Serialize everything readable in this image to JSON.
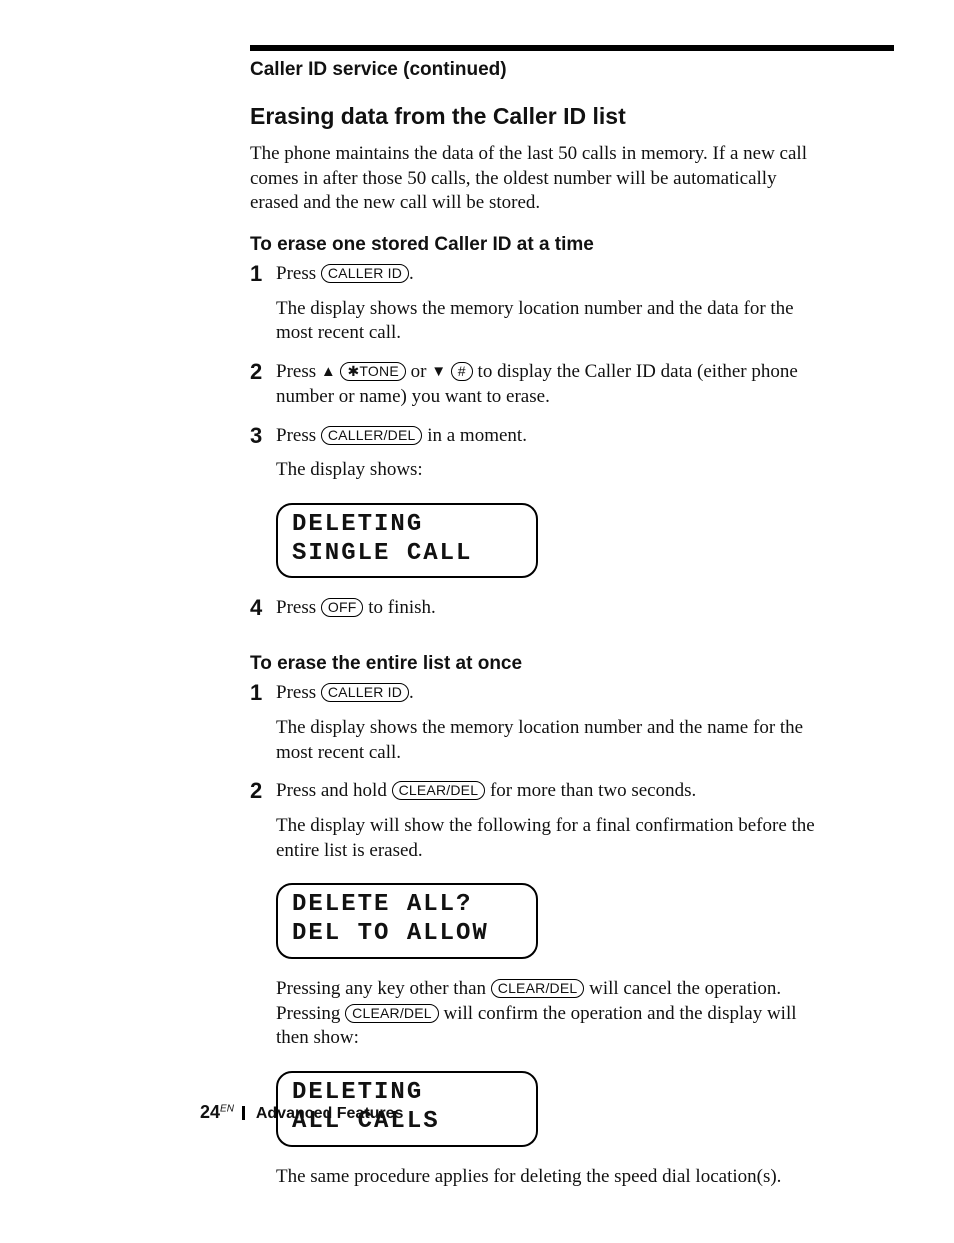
{
  "running_head": "Caller ID service (continued)",
  "section_title": "Erasing data from the Caller ID list",
  "intro": "The phone maintains the data of the last 50 calls in memory. If a new call comes in after those 50 calls, the oldest number will be automatically erased and the new call will be stored.",
  "sectionA": {
    "heading": "To erase one stored Caller ID at a time",
    "steps": {
      "s1_press": "Press ",
      "s1_key": "CALLER ID",
      "s1_after": ".",
      "s1_body": "The display shows the memory location number and the data for the most recent call.",
      "s2_press": "Press ",
      "s2_key1": "✱TONE",
      "s2_or": " or ",
      "s2_key2": "#",
      "s2_tail": " to display the Caller ID data (either phone number or name) you want to erase.",
      "s3_press": "Press ",
      "s3_key": "CALLER/DEL",
      "s3_tail": " in a moment.",
      "s3_body": "The display shows:",
      "lcd1_l1": "DELETING",
      "lcd1_l2": "SINGLE CALL",
      "s4_press": "Press ",
      "s4_key": "OFF",
      "s4_tail": " to finish."
    }
  },
  "sectionB": {
    "heading": "To erase the entire list at once",
    "steps": {
      "s1_press": "Press ",
      "s1_key": "CALLER ID",
      "s1_after": ".",
      "s1_body": "The display shows the memory location number and the name for the most recent call.",
      "s2_press": "Press and hold ",
      "s2_key": "CLEAR/DEL",
      "s2_tail": " for more than two seconds.",
      "s2_body": "The display will show the following for a final confirmation before the entire list is erased.",
      "lcd2_l1": "DELETE ALL?",
      "lcd2_l2": "DEL TO ALLOW",
      "s2_p2a": "Pressing any key other than ",
      "s2_p2_key1": "CLEAR/DEL",
      "s2_p2b": " will cancel the operation. Pressing ",
      "s2_p2_key2": "CLEAR/DEL",
      "s2_p2c": " will confirm the operation and the display will then show:",
      "lcd3_l1": "DELETING",
      "lcd3_l2": "ALL CALLS",
      "tail_note": "The same procedure applies for deleting the speed dial location(s)."
    }
  },
  "footer": {
    "page": "24",
    "sup": "EN",
    "label": "Advanced Features"
  }
}
